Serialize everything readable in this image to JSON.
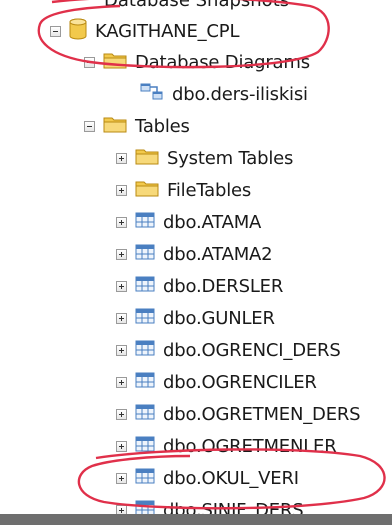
{
  "tree": {
    "partial_top_label": "Database Snapshots",
    "server_db": "KAGITHANE_CPL",
    "diagrams_folder": "Database Diagrams",
    "diagram_item": "dbo.ders-iliskisi",
    "tables_folder": "Tables",
    "system_tables": "System Tables",
    "file_tables": "FileTables",
    "tables": [
      "dbo.ATAMA",
      "dbo.ATAMA2",
      "dbo.DERSLER",
      "dbo.GUNLER",
      "dbo.OGRENCI_DERS",
      "dbo.OGRENCILER",
      "dbo.OGRETMEN_DERS",
      "dbo.OGRETMENLER",
      "dbo.OKUL_VERI",
      "dbo.SINIF_DERS"
    ]
  },
  "icons": {
    "database": "database-icon",
    "folder": "folder-icon",
    "diagram": "diagram-icon",
    "table": "table-icon",
    "expand": "expand-icon",
    "collapse": "collapse-icon"
  },
  "colors": {
    "annotation_circle": "#e0304a",
    "folder_yellow": "#f2c94c",
    "table_blue": "#4a7fc1"
  }
}
